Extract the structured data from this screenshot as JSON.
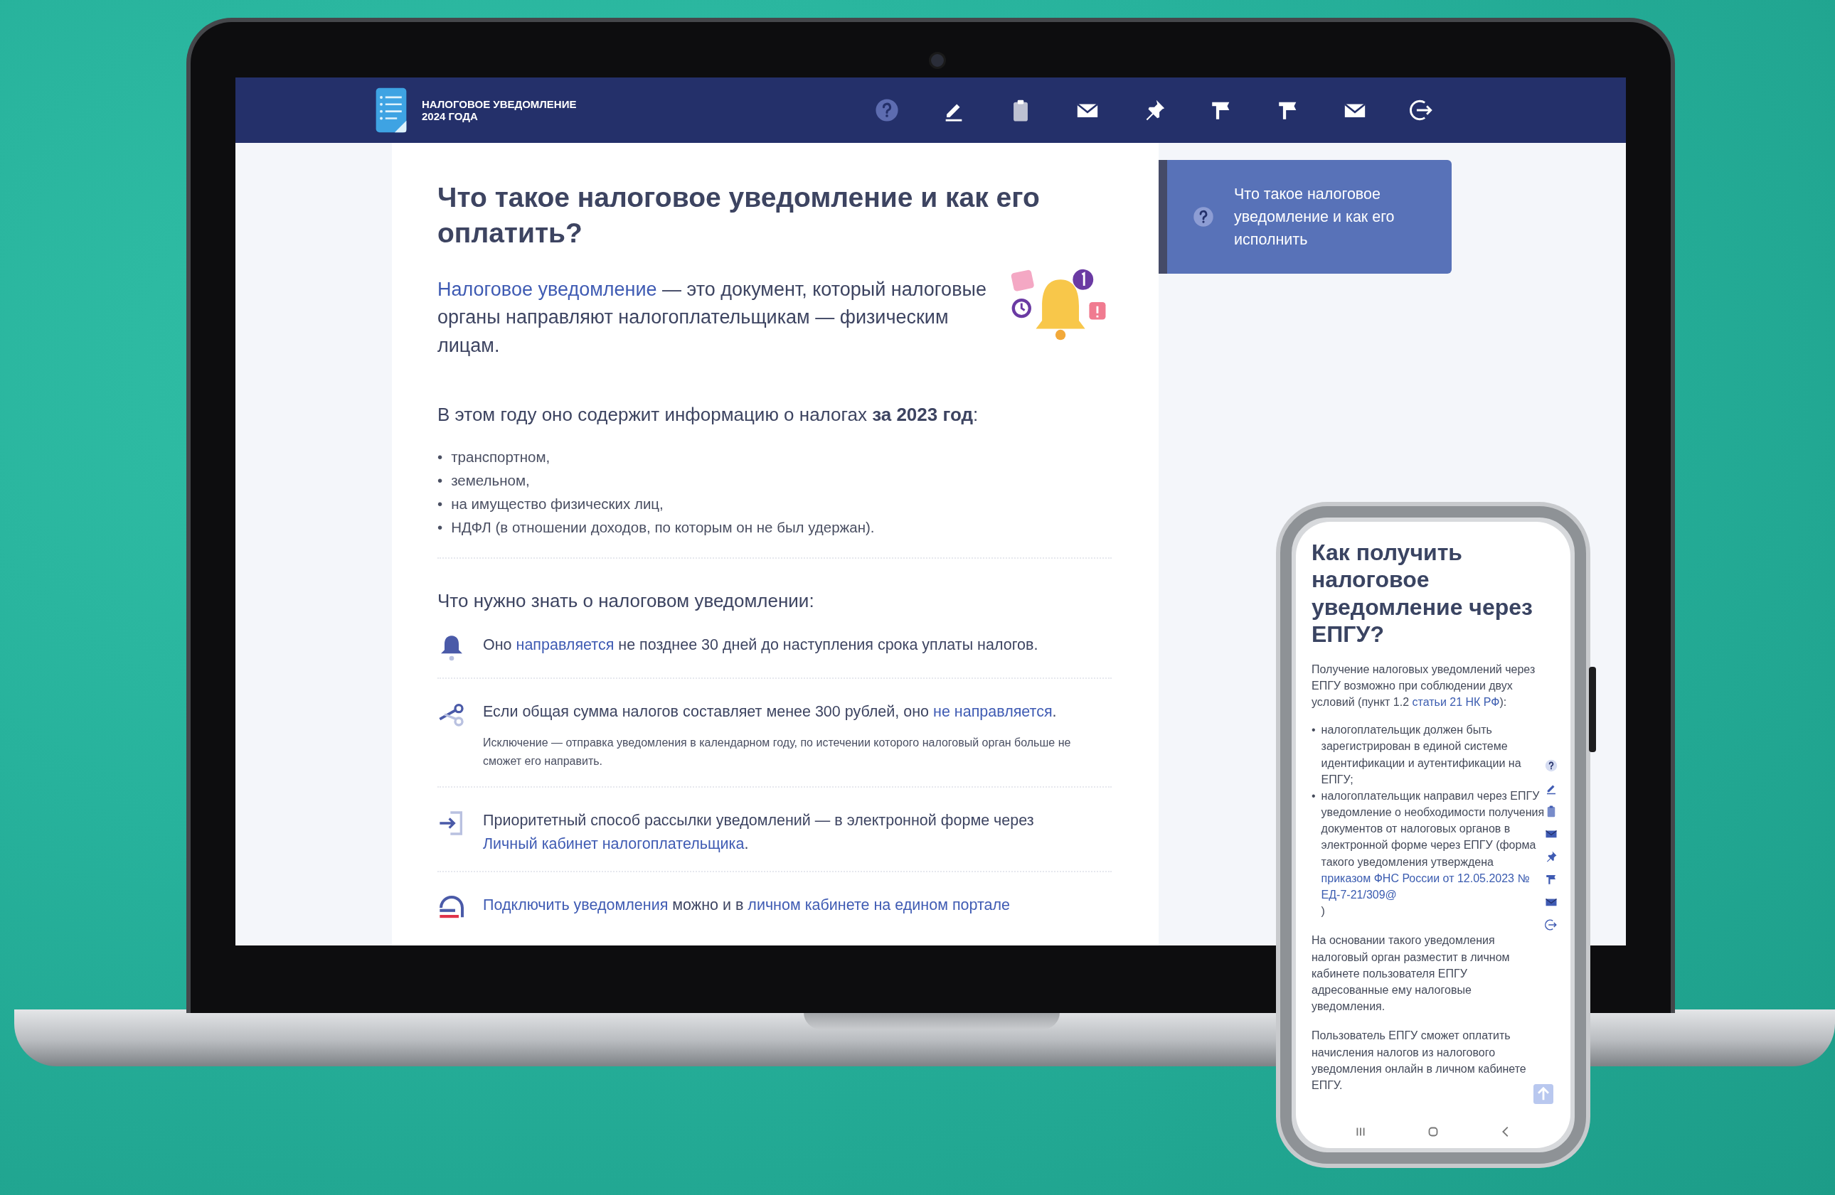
{
  "header": {
    "logo_lines": [
      "НАЛОГОВОЕ УВЕДОМЛЕНИЕ",
      "2024 ГОДА"
    ],
    "nav": [
      {
        "kind": "help"
      },
      {
        "kind": "pen"
      },
      {
        "kind": "clipboard"
      },
      {
        "kind": "mail"
      },
      {
        "kind": "pin"
      },
      {
        "kind": "flag"
      },
      {
        "kind": "flag"
      },
      {
        "kind": "mail"
      },
      {
        "kind": "exit"
      }
    ]
  },
  "article": {
    "title": "Что такое налоговое уведомление и как его оплатить?",
    "intro": [
      {
        "text": "Налоговое уведомление",
        "link": true
      },
      {
        "text": " — это документ, который налоговые органы направляют налогоплательщикам — физическим лицам.",
        "link": false
      }
    ],
    "year_line": "В этом году оно содержит информацию о налогах **за 2023 год**:",
    "bullet": "•",
    "taxes": [
      "транспортном,",
      "земельном,",
      "на имущество физических лиц,",
      "НДФЛ (в отношении доходов, по которым он не был удержан)."
    ],
    "section_title": "Что нужно знать о налоговом уведомлении:",
    "facts": [
      {
        "kind": "bell",
        "segments": [
          {
            "text": "Оно ",
            "link": false
          },
          {
            "text": "направляется",
            "link": true
          },
          {
            "text": " не позднее 30 дней до наступления срока уплаты налогов.",
            "link": false
          }
        ]
      },
      {
        "kind": "scissors",
        "segments": [
          {
            "text": "Если общая сумма налогов составляет менее 300 рублей, оно ",
            "link": false
          },
          {
            "text": "не направляется",
            "link": true
          },
          {
            "text": ".",
            "link": false
          }
        ],
        "note": "Исключение — отправка уведомления в календарном году, по истечении которого налоговый орган больше не сможет его направить."
      },
      {
        "kind": "login",
        "segments": [
          {
            "text": "Приоритетный способ рассылки уведомлений — в электронной форме через ",
            "link": false
          },
          {
            "text": "Личный кабинет налогоплательщика",
            "link": true
          },
          {
            "text": ".",
            "link": false
          }
        ]
      },
      {
        "kind": "portal",
        "segments": [
          {
            "text": "Подключить уведомления",
            "link": true
          },
          {
            "text": " можно и в ",
            "link": false
          },
          {
            "text": "личном кабинете на едином портале",
            "link": true
          }
        ]
      }
    ]
  },
  "sidebar_card": {
    "text": "Что такое налоговое уведомление и как его исполнить"
  },
  "phone": {
    "title": "Как получить налоговое уведомление через ЕПГУ?",
    "intro": [
      {
        "text": "Получение налоговых уведомлений через ЕПГУ возможно при соблюдении двух условий (пункт 1.2 ",
        "link": false
      },
      {
        "text": "статьи 21 НК РФ",
        "link": true
      },
      {
        "text": "):",
        "link": false
      }
    ],
    "bullet": "•",
    "bullets": [
      [
        {
          "text": "налогоплательщик должен быть зарегистрирован в единой системе идентификации и аутентификации на ЕПГУ;",
          "link": false
        }
      ],
      [
        {
          "text": "налогоплательщик направил через ЕПГУ уведомление о необходимости получения документов от налоговых органов в электронной форме через ЕПГУ (форма такого уведомления утверждена ",
          "link": false
        },
        {
          "text": "приказом ФНС России от 12.05.2023 № ЕД-7-21/309@",
          "link": true
        },
        {
          "text": ")",
          "link": false
        }
      ]
    ],
    "paragraphs": [
      [
        {
          "text": "На основании такого уведомления налоговый орган разместит в личном кабинете пользователя ЕПГУ адресованные ему налоговые уведомления.",
          "link": false
        }
      ],
      [
        {
          "text": "Пользователь ЕПГУ сможет оплатить начисления налогов из налогового уведомления онлайн в личном кабинете ЕПГУ.",
          "link": false
        }
      ]
    ],
    "toolbar": [
      {
        "kind": "help"
      },
      {
        "kind": "pen"
      },
      {
        "kind": "clipboard"
      },
      {
        "kind": "mail"
      },
      {
        "kind": "pin"
      },
      {
        "kind": "flag"
      },
      {
        "kind": "mail"
      },
      {
        "kind": "exit"
      }
    ]
  }
}
